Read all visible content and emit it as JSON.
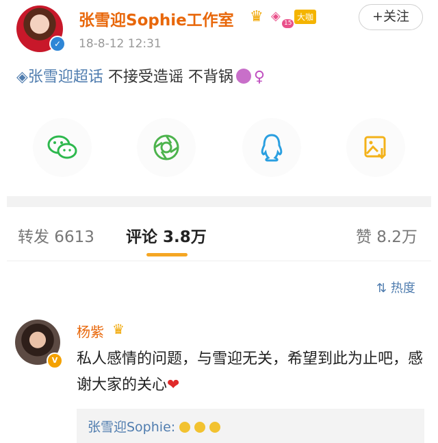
{
  "header": {
    "username": "张雪迎Sophie工作室",
    "vip_level": "15",
    "bigshot_badge": "大咖",
    "follow_label": "+关注",
    "timestamp": "18-8-12 12:31"
  },
  "post": {
    "topic_link": "◈张雪迎超话",
    "text": "不接受造谣 不背锅",
    "emoji": "♀"
  },
  "share": {
    "items": [
      {
        "icon": "wechat-icon",
        "color": "#2db84d"
      },
      {
        "icon": "moments-icon",
        "color": "#4db34d"
      },
      {
        "icon": "qq-icon",
        "color": "#2a9fe0"
      },
      {
        "icon": "save-image-icon",
        "color": "#f3b21a"
      }
    ]
  },
  "tabs": {
    "repost": "转发 6613",
    "comment": "评论 3.8万",
    "like": "赞 8.2万"
  },
  "sort_label": "热度",
  "comment": {
    "username": "杨紫",
    "text": "私人感情的问题，与雪迎无关，希望到此为止吧，感谢大家的关心",
    "heart": "❤",
    "reply_preview": "张雪迎Sophie:"
  },
  "colors": {
    "accent": "#e8670a",
    "link": "#507daf",
    "tab_underline": "#f5a623"
  }
}
